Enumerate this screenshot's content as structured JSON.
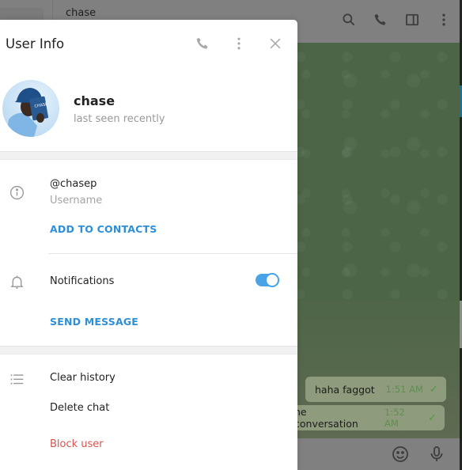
{
  "background": {
    "chat_title": "chase",
    "top_icons": [
      "search-icon",
      "phone-icon",
      "sidebar-toggle-icon",
      "more-vertical-icon"
    ],
    "messages": [
      {
        "text": "haha faggot",
        "time": "1:51 AM",
        "status": "✓"
      },
      {
        "text": "he conversation",
        "time": "1:52 AM",
        "status": "✓"
      }
    ],
    "composer_icons": [
      "emoji-icon",
      "microphone-icon"
    ],
    "colors": {
      "wallpaper": "#4b6546",
      "bubble": "#8f9b7d",
      "time": "#5f8e4e"
    }
  },
  "dialog": {
    "title": "User Info",
    "header_icons": [
      "phone-icon",
      "more-vertical-icon",
      "close-icon"
    ],
    "profile": {
      "name": "chase",
      "status": "last seen recently"
    },
    "info": {
      "username_value": "@chasep",
      "username_label": "Username",
      "add_to_contacts": "ADD TO CONTACTS",
      "notifications_label": "Notifications",
      "notifications_enabled": true,
      "send_message": "SEND MESSAGE"
    },
    "actions": {
      "clear_history": "Clear history",
      "delete_chat": "Delete chat",
      "block_user": "Block user"
    },
    "colors": {
      "accent": "#2f8fd6",
      "toggle": "#49a3e6",
      "danger": "#d9534f"
    }
  }
}
